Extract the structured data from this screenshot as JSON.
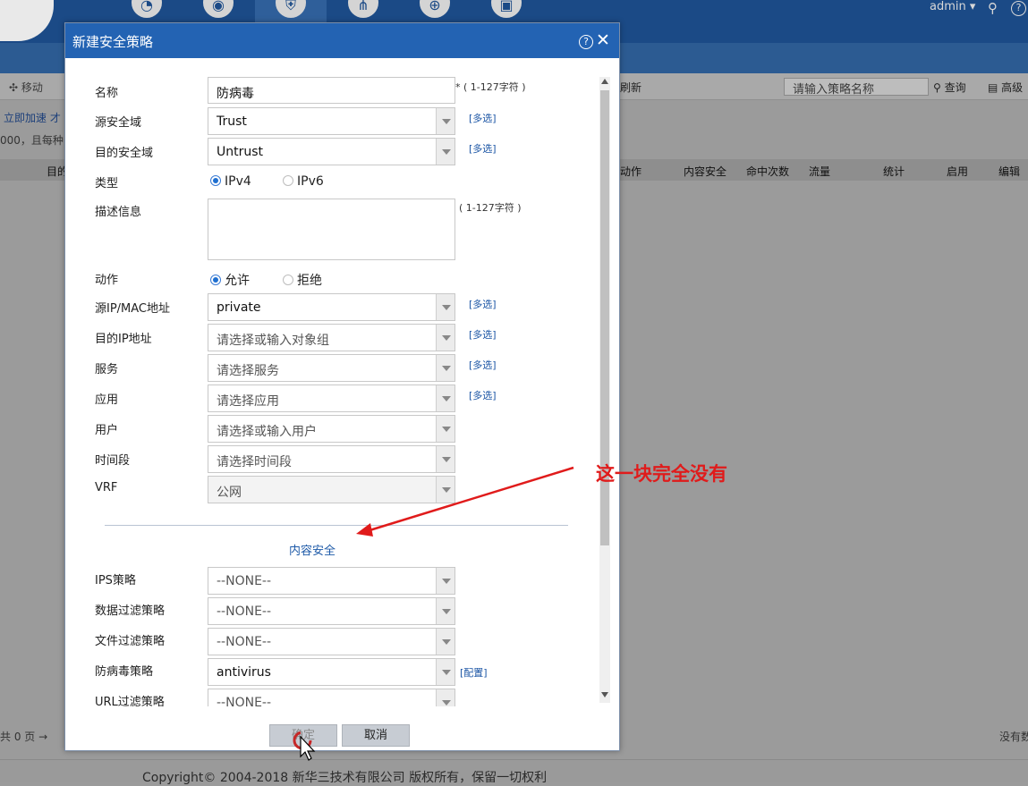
{
  "header": {
    "user": "admin",
    "nav_icons": [
      "dashboard-icon",
      "monitor-icon",
      "policy-shield-icon",
      "network-icon",
      "globe-icon",
      "system-icon"
    ]
  },
  "toolbar": {
    "move": "移动",
    "refresh": "刷新",
    "search_placeholder": "请输入策略名称",
    "query": "查询",
    "advanced": "高级"
  },
  "notices": {
    "line1": "立即加速 才",
    "line2": "000，且每种"
  },
  "table": {
    "columns": [
      "目的",
      "动作",
      "内容安全",
      "命中次数",
      "流量",
      "统计",
      "启用",
      "编辑"
    ]
  },
  "pager": {
    "left": "共 0 页",
    "right": "没有数"
  },
  "footer": {
    "copyright": "Copyright© 2004-2018 新华三技术有限公司 版权所有，保留一切权利"
  },
  "dialog": {
    "title": "新建安全策略",
    "fields": {
      "name": {
        "label": "名称",
        "value": "防病毒",
        "hint": "* ( 1-127字符 )"
      },
      "src_zone": {
        "label": "源安全域",
        "value": "Trust",
        "link": "[多选]"
      },
      "dst_zone": {
        "label": "目的安全域",
        "value": "Untrust",
        "link": "[多选]"
      },
      "type": {
        "label": "类型",
        "options": [
          "IPv4",
          "IPv6"
        ],
        "selected": "IPv4"
      },
      "desc": {
        "label": "描述信息",
        "hint": "( 1-127字符 )"
      },
      "action": {
        "label": "动作",
        "options": [
          "允许",
          "拒绝"
        ],
        "selected": "允许"
      },
      "src_ip": {
        "label": "源IP/MAC地址",
        "value": "private",
        "link": "[多选]"
      },
      "dst_ip": {
        "label": "目的IP地址",
        "placeholder": "请选择或输入对象组",
        "link": "[多选]"
      },
      "service": {
        "label": "服务",
        "placeholder": "请选择服务",
        "link": "[多选]"
      },
      "app": {
        "label": "应用",
        "placeholder": "请选择应用",
        "link": "[多选]"
      },
      "user": {
        "label": "用户",
        "placeholder": "请选择或输入用户"
      },
      "time": {
        "label": "时间段",
        "placeholder": "请选择时间段"
      },
      "vrf": {
        "label": "VRF",
        "value": "公网"
      }
    },
    "section_title": "内容安全",
    "content_security": {
      "ips": {
        "label": "IPS策略",
        "value": "--NONE--"
      },
      "data_filter": {
        "label": "数据过滤策略",
        "value": "--NONE--"
      },
      "file_filter": {
        "label": "文件过滤策略",
        "value": "--NONE--"
      },
      "antivirus": {
        "label": "防病毒策略",
        "value": "antivirus",
        "link": "[配置]"
      },
      "url_filter": {
        "label": "URL过滤策略",
        "value": "--NONE--"
      }
    },
    "buttons": {
      "ok": "确定",
      "cancel": "取消"
    }
  },
  "annotation": {
    "text": "这一块完全没有",
    "color": "#e01b1b"
  }
}
